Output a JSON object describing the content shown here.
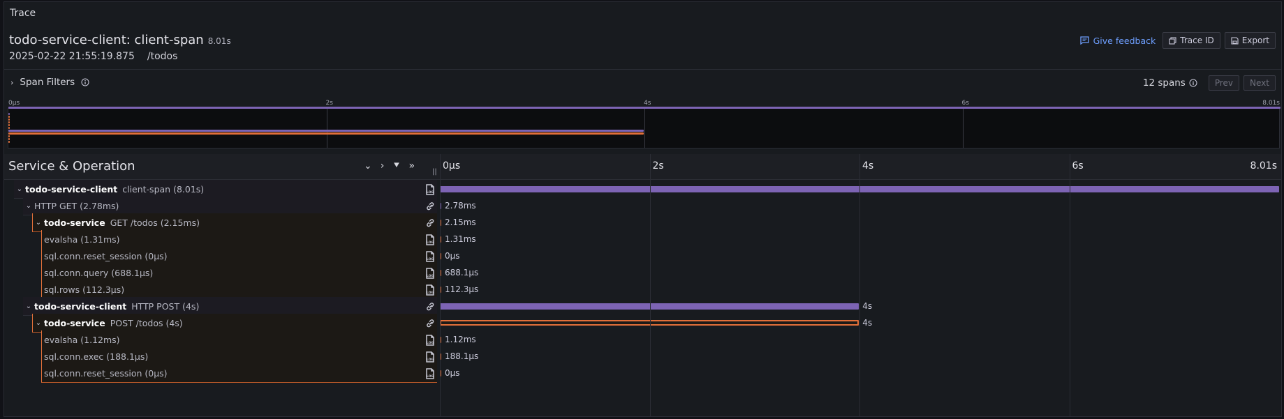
{
  "panel": {
    "title": "Trace"
  },
  "trace": {
    "title": "todo-service-client: client-span",
    "duration": "8.01s",
    "start": "2025-02-22 21:55:19.875",
    "path": "/todos"
  },
  "actions": {
    "feedback": "Give feedback",
    "trace_id": "Trace ID",
    "export": "Export"
  },
  "filters": {
    "label": "Span Filters",
    "span_count": "12 spans",
    "prev": "Prev",
    "next": "Next"
  },
  "minimap": {
    "ticks": [
      "0μs",
      "2s",
      "4s",
      "6s",
      "8.01s"
    ]
  },
  "grid": {
    "header_label": "Service & Operation",
    "ticks": [
      "0μs",
      "2s",
      "4s",
      "6s",
      "8.01s"
    ]
  },
  "colors": {
    "client": "#7d64b4",
    "service": "#e2703a"
  },
  "total_duration_s": 8.01,
  "spans": [
    {
      "service": "todo-service-client",
      "operation": "client-span (8.01s)",
      "duration_label": "",
      "start_s": 0,
      "duration_s": 8.01,
      "depth": 0,
      "collapsible": true,
      "icon": "log-icon",
      "color": "client"
    },
    {
      "service": "",
      "operation": "HTTP GET (2.78ms)",
      "duration_label": "2.78ms",
      "start_s": 0,
      "duration_s": 0.00278,
      "depth": 1,
      "collapsible": true,
      "icon": "link-icon",
      "color": "client"
    },
    {
      "service": "todo-service",
      "operation": "GET /todos (2.15ms)",
      "duration_label": "2.15ms",
      "start_s": 0,
      "duration_s": 0.00215,
      "depth": 2,
      "collapsible": true,
      "icon": "link-icon",
      "color": "service"
    },
    {
      "service": "",
      "operation": "evalsha (1.31ms)",
      "duration_label": "1.31ms",
      "start_s": 0,
      "duration_s": 0.00131,
      "depth": 3,
      "collapsible": false,
      "icon": "log-icon",
      "color": "service"
    },
    {
      "service": "",
      "operation": "sql.conn.reset_session (0μs)",
      "duration_label": "0μs",
      "start_s": 0,
      "duration_s": 0,
      "depth": 3,
      "collapsible": false,
      "icon": "log-icon",
      "color": "service"
    },
    {
      "service": "",
      "operation": "sql.conn.query (688.1μs)",
      "duration_label": "688.1μs",
      "start_s": 0,
      "duration_s": 0.0006881,
      "depth": 3,
      "collapsible": false,
      "icon": "log-icon",
      "color": "service"
    },
    {
      "service": "",
      "operation": "sql.rows (112.3μs)",
      "duration_label": "112.3μs",
      "start_s": 0,
      "duration_s": 0.0001123,
      "depth": 3,
      "collapsible": false,
      "icon": "log-icon",
      "color": "service"
    },
    {
      "service": "todo-service-client",
      "operation": "HTTP POST (4s)",
      "duration_label": "4s",
      "start_s": 0,
      "duration_s": 4,
      "depth": 1,
      "collapsible": true,
      "icon": "link-icon",
      "color": "client"
    },
    {
      "service": "todo-service",
      "operation": "POST /todos (4s)",
      "duration_label": "4s",
      "start_s": 0,
      "duration_s": 4,
      "depth": 2,
      "collapsible": true,
      "icon": "link-icon",
      "color": "service"
    },
    {
      "service": "",
      "operation": "evalsha (1.12ms)",
      "duration_label": "1.12ms",
      "start_s": 0,
      "duration_s": 0.00112,
      "depth": 3,
      "collapsible": false,
      "icon": "log-icon",
      "color": "service"
    },
    {
      "service": "",
      "operation": "sql.conn.exec (188.1μs)",
      "duration_label": "188.1μs",
      "start_s": 0,
      "duration_s": 0.0001881,
      "depth": 3,
      "collapsible": false,
      "icon": "log-icon",
      "color": "service"
    },
    {
      "service": "",
      "operation": "sql.conn.reset_session (0μs)",
      "duration_label": "0μs",
      "start_s": 0,
      "duration_s": 0,
      "depth": 3,
      "collapsible": false,
      "icon": "log-icon",
      "color": "service"
    }
  ]
}
